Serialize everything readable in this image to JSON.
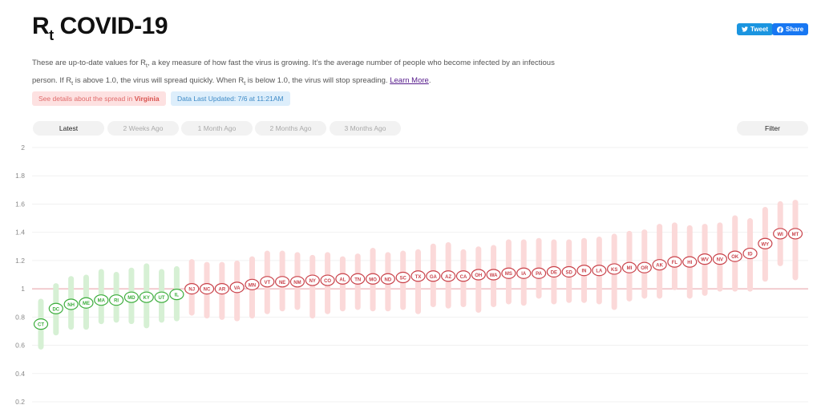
{
  "header": {
    "title_main": "R",
    "title_sub": "t",
    "title_rest": "COVID-19",
    "tweet_label": "Tweet",
    "share_label": "Share"
  },
  "intro": {
    "p1": "These are up-to-date values for R",
    "p1_sub": "t",
    "p2": ", a key measure of how fast the virus is growing. It’s the average number of people who become infected by an infectious person. If R",
    "p2_sub": "t",
    "p3": " is above 1.0, the virus will spread quickly. When R",
    "p3_sub": "t",
    "p4": " is below 1.0, the virus will stop spreading. ",
    "link": "Learn More",
    "p5": "."
  },
  "details": {
    "prefix": "See details about the spread in ",
    "state": "Virginia",
    "updated": "Data Last Updated: 7/6 at 11:21AM"
  },
  "tabs": [
    "Latest",
    "2 Weeks Ago",
    "1 Month Ago",
    "2 Months Ago",
    "3 Months Ago"
  ],
  "filter_label": "Filter",
  "colors": {
    "green": "#3cad3c",
    "green_band": "#d6f0d4",
    "red": "#c9424a",
    "red_band": "#fbd9d9",
    "ref_line": "#e8a0a6",
    "grid": "#f1f1f1"
  },
  "chart_data": {
    "type": "scatter",
    "ylim": [
      0.2,
      2.0
    ],
    "yticks": [
      0.2,
      0.4,
      0.6,
      0.8,
      1,
      1.2,
      1.4,
      1.6,
      1.8,
      2
    ],
    "reference_line": 1.0,
    "states": [
      {
        "code": "CT",
        "value": 0.75,
        "low": 0.57,
        "high": 0.93
      },
      {
        "code": "DC",
        "value": 0.86,
        "low": 0.67,
        "high": 1.04
      },
      {
        "code": "NH",
        "value": 0.89,
        "low": 0.71,
        "high": 1.09
      },
      {
        "code": "ME",
        "value": 0.9,
        "low": 0.71,
        "high": 1.1
      },
      {
        "code": "MA",
        "value": 0.92,
        "low": 0.75,
        "high": 1.14
      },
      {
        "code": "RI",
        "value": 0.92,
        "low": 0.76,
        "high": 1.12
      },
      {
        "code": "MD",
        "value": 0.94,
        "low": 0.75,
        "high": 1.15
      },
      {
        "code": "KY",
        "value": 0.94,
        "low": 0.72,
        "high": 1.18
      },
      {
        "code": "UT",
        "value": 0.94,
        "low": 0.76,
        "high": 1.14
      },
      {
        "code": "IL",
        "value": 0.96,
        "low": 0.77,
        "high": 1.16
      },
      {
        "code": "NJ",
        "value": 1.0,
        "low": 0.81,
        "high": 1.21
      },
      {
        "code": "NC",
        "value": 1.0,
        "low": 0.79,
        "high": 1.19
      },
      {
        "code": "AR",
        "value": 1.0,
        "low": 0.78,
        "high": 1.19
      },
      {
        "code": "VA",
        "value": 1.01,
        "low": 0.77,
        "high": 1.2
      },
      {
        "code": "MN",
        "value": 1.03,
        "low": 0.79,
        "high": 1.23
      },
      {
        "code": "VT",
        "value": 1.05,
        "low": 0.82,
        "high": 1.27
      },
      {
        "code": "NE",
        "value": 1.05,
        "low": 0.84,
        "high": 1.27
      },
      {
        "code": "NM",
        "value": 1.05,
        "low": 0.85,
        "high": 1.26
      },
      {
        "code": "NY",
        "value": 1.06,
        "low": 0.79,
        "high": 1.24
      },
      {
        "code": "CO",
        "value": 1.06,
        "low": 0.82,
        "high": 1.26
      },
      {
        "code": "AL",
        "value": 1.07,
        "low": 0.84,
        "high": 1.23
      },
      {
        "code": "TN",
        "value": 1.07,
        "low": 0.85,
        "high": 1.25
      },
      {
        "code": "MO",
        "value": 1.07,
        "low": 0.84,
        "high": 1.29
      },
      {
        "code": "ND",
        "value": 1.07,
        "low": 0.84,
        "high": 1.26
      },
      {
        "code": "SC",
        "value": 1.08,
        "low": 0.85,
        "high": 1.27
      },
      {
        "code": "TX",
        "value": 1.09,
        "low": 0.82,
        "high": 1.28
      },
      {
        "code": "GA",
        "value": 1.09,
        "low": 0.87,
        "high": 1.32
      },
      {
        "code": "AZ",
        "value": 1.09,
        "low": 0.86,
        "high": 1.33
      },
      {
        "code": "CA",
        "value": 1.09,
        "low": 0.87,
        "high": 1.28
      },
      {
        "code": "OH",
        "value": 1.1,
        "low": 0.83,
        "high": 1.3
      },
      {
        "code": "WA",
        "value": 1.1,
        "low": 0.87,
        "high": 1.31
      },
      {
        "code": "MS",
        "value": 1.11,
        "low": 0.89,
        "high": 1.35
      },
      {
        "code": "IA",
        "value": 1.11,
        "low": 0.88,
        "high": 1.35
      },
      {
        "code": "PA",
        "value": 1.11,
        "low": 0.93,
        "high": 1.36
      },
      {
        "code": "DE",
        "value": 1.12,
        "low": 0.89,
        "high": 1.35
      },
      {
        "code": "SD",
        "value": 1.12,
        "low": 0.9,
        "high": 1.35
      },
      {
        "code": "IN",
        "value": 1.13,
        "low": 0.9,
        "high": 1.36
      },
      {
        "code": "LA",
        "value": 1.13,
        "low": 0.89,
        "high": 1.37
      },
      {
        "code": "KS",
        "value": 1.14,
        "low": 0.85,
        "high": 1.39
      },
      {
        "code": "MI",
        "value": 1.15,
        "low": 0.91,
        "high": 1.41
      },
      {
        "code": "OR",
        "value": 1.15,
        "low": 0.93,
        "high": 1.42
      },
      {
        "code": "AK",
        "value": 1.17,
        "low": 0.93,
        "high": 1.46
      },
      {
        "code": "FL",
        "value": 1.19,
        "low": 0.99,
        "high": 1.47
      },
      {
        "code": "HI",
        "value": 1.19,
        "low": 0.93,
        "high": 1.45
      },
      {
        "code": "WV",
        "value": 1.21,
        "low": 0.95,
        "high": 1.46
      },
      {
        "code": "NV",
        "value": 1.21,
        "low": 0.98,
        "high": 1.47
      },
      {
        "code": "OK",
        "value": 1.23,
        "low": 0.98,
        "high": 1.52
      },
      {
        "code": "ID",
        "value": 1.25,
        "low": 0.98,
        "high": 1.5
      },
      {
        "code": "WY",
        "value": 1.32,
        "low": 1.05,
        "high": 1.58
      },
      {
        "code": "WI",
        "value": 1.39,
        "low": 1.16,
        "high": 1.62
      },
      {
        "code": "MT",
        "value": 1.39,
        "low": 1.06,
        "high": 1.63
      }
    ]
  }
}
